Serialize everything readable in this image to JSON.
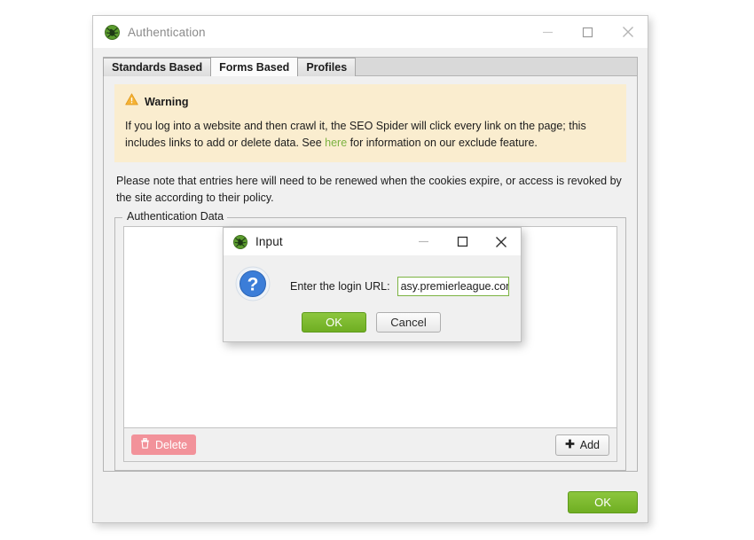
{
  "main_window": {
    "title": "Authentication",
    "icon": "spider-icon",
    "window_controls": {
      "minimize": "minimize-icon",
      "maximize": "maximize-icon",
      "close": "close-icon"
    },
    "tabs": [
      {
        "label": "Standards Based",
        "active": false
      },
      {
        "label": "Forms Based",
        "active": true
      },
      {
        "label": "Profiles",
        "active": false
      }
    ],
    "warning": {
      "icon": "warning-triangle-icon",
      "title": "Warning",
      "text_before_link": "If you log into a website and then crawl it, the SEO Spider will click every link on the page; this includes links to add or delete data. See ",
      "link_text": "here",
      "text_after_link": " for information on our exclude feature.",
      "background_color": "#faedcf",
      "link_color": "#7cb342"
    },
    "note": "Please note that entries here will need to be renewed when the cookies expire, or access is revoked by the site according to their policy.",
    "group": {
      "legend": "Authentication Data",
      "rows": [],
      "delete_button": {
        "label": "Delete",
        "icon": "trash-icon",
        "enabled": false,
        "color": "#f2929a"
      },
      "add_button": {
        "label": "Add",
        "icon": "plus-icon",
        "enabled": true
      }
    },
    "ok_button": {
      "label": "OK",
      "color": "#7cb63a"
    }
  },
  "input_dialog": {
    "title": "Input",
    "icon": "spider-icon",
    "window_controls": {
      "minimize": "minimize-icon",
      "maximize": "maximize-icon",
      "close": "close-icon"
    },
    "question_icon": "question-mark-icon",
    "prompt_label": "Enter the login URL:",
    "input": {
      "value": "asy.premierleague.com/",
      "placeholder": "",
      "focused": true,
      "border_color": "#7cb342"
    },
    "ok_button": {
      "label": "OK",
      "color": "#7cb63a"
    },
    "cancel_button": {
      "label": "Cancel"
    }
  }
}
